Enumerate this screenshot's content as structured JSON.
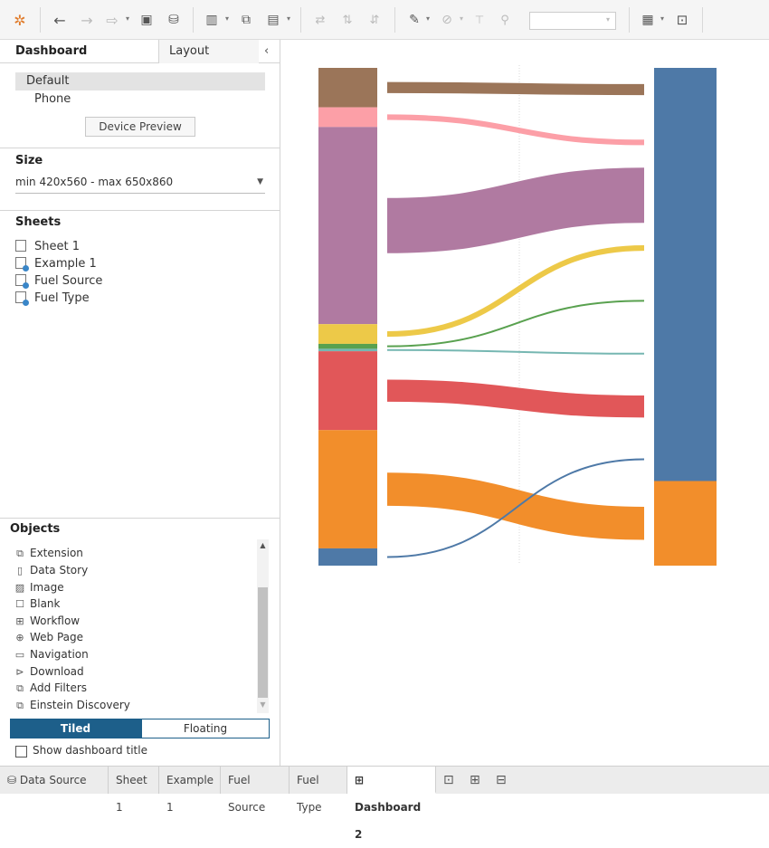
{
  "toolbar": {
    "tools": [
      "tableau-logo-icon",
      "undo-icon",
      "redo-icon",
      "redo-menu-icon",
      "save-icon",
      "new-datasource-icon",
      "new-worksheet-icon",
      "duplicate-sheet-icon",
      "clear-sheet-icon",
      "swap-icon",
      "sort-ascending-icon",
      "sort-descending-icon",
      "highlight-icon",
      "group-icon",
      "label-icon",
      "pin-icon",
      "show-me-icon",
      "presentation-icon"
    ]
  },
  "left_panel": {
    "tabs": {
      "dashboard": "Dashboard",
      "layout": "Layout"
    },
    "collapse_icon": "‹",
    "device": {
      "default": "Default",
      "phone": "Phone",
      "preview_button": "Device Preview"
    },
    "size": {
      "title": "Size",
      "value": "min 420x560 - max 650x860"
    },
    "sheets": {
      "title": "Sheets",
      "items": [
        {
          "label": "Sheet 1",
          "icon": "worksheet-icon"
        },
        {
          "label": "Example 1",
          "icon": "worksheet-datasource-icon"
        },
        {
          "label": "Fuel Source",
          "icon": "worksheet-datasource-icon"
        },
        {
          "label": "Fuel Type",
          "icon": "worksheet-datasource-icon"
        }
      ]
    },
    "objects": {
      "title": "Objects",
      "items": [
        {
          "label": "Extension",
          "icon": "extension-icon"
        },
        {
          "label": "Data Story",
          "icon": "data-story-icon"
        },
        {
          "label": "Image",
          "icon": "image-icon"
        },
        {
          "label": "Blank",
          "icon": "blank-icon"
        },
        {
          "label": "Workflow",
          "icon": "workflow-icon"
        },
        {
          "label": "Web Page",
          "icon": "web-page-icon"
        },
        {
          "label": "Navigation",
          "icon": "navigation-icon"
        },
        {
          "label": "Download",
          "icon": "download-icon"
        },
        {
          "label": "Add Filters",
          "icon": "add-filters-icon"
        },
        {
          "label": "Einstein Discovery",
          "icon": "einstein-discovery-icon"
        }
      ],
      "tiled_label": "Tiled",
      "floating_label": "Floating",
      "show_title_label": "Show dashboard title",
      "show_title_checked": false
    }
  },
  "bottom_tabs": {
    "data_source": "Data Source",
    "sheet_tabs": [
      "Sheet 1",
      "Example 1",
      "Fuel Source",
      "Fuel Type"
    ],
    "active_tab": "Dashboard 2",
    "icons": [
      "new-worksheet-tab-icon",
      "new-dashboard-tab-icon",
      "new-story-tab-icon"
    ]
  },
  "chart_data": {
    "type": "sankey",
    "left_nodes": [
      {
        "color": "#9b7559",
        "value": 8
      },
      {
        "color": "#fc9fa7",
        "value": 4
      },
      {
        "color": "#b07aa1",
        "value": 40
      },
      {
        "color": "#edc948",
        "value": 4
      },
      {
        "color": "#59a14f",
        "value": 1
      },
      {
        "color": "#76b7b2",
        "value": 0.5
      },
      {
        "color": "#e15759",
        "value": 16
      },
      {
        "color": "#f28e2b",
        "value": 24
      },
      {
        "color": "#4e79a7",
        "value": 3.5
      }
    ],
    "right_nodes": [
      {
        "color": "#4e79a7",
        "value": 83
      },
      {
        "color": "#f28e2b",
        "value": 17
      }
    ],
    "links": [
      {
        "from": 0,
        "to": 0,
        "color": "#9b7559"
      },
      {
        "from": 1,
        "to": 0,
        "color": "#fc9fa7"
      },
      {
        "from": 2,
        "to": 0,
        "color": "#b07aa1"
      },
      {
        "from": 3,
        "to": 0,
        "color": "#edc948"
      },
      {
        "from": 4,
        "to": 0,
        "color": "#59a14f"
      },
      {
        "from": 5,
        "to": 0,
        "color": "#76b7b2"
      },
      {
        "from": 6,
        "to": 0,
        "color": "#e15759"
      },
      {
        "from": 7,
        "to": 1,
        "color": "#f28e2b"
      },
      {
        "from": 8,
        "to": 0,
        "color": "#4e79a7"
      }
    ]
  }
}
